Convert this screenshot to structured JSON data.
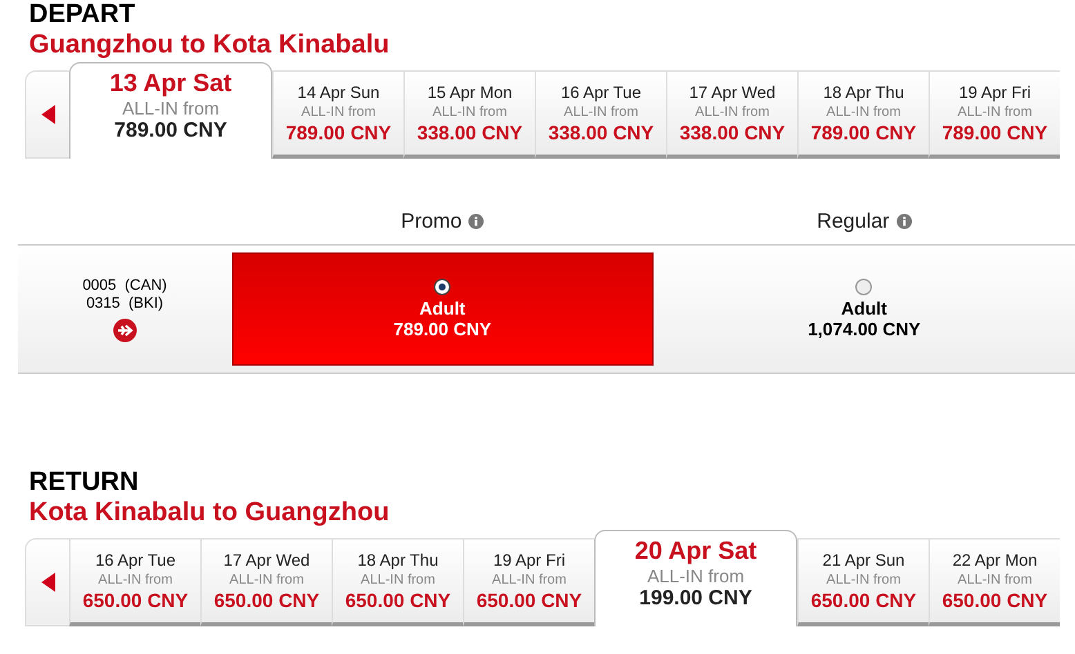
{
  "depart": {
    "heading": "DEPART",
    "route": "Guangzhou  to  Kota Kinabalu",
    "dates": [
      {
        "date": "13 Apr Sat",
        "label": "ALL-IN from",
        "price": "789.00 CNY",
        "selected": true
      },
      {
        "date": "14 Apr Sun",
        "label": "ALL-IN from",
        "price": "789.00 CNY",
        "selected": false
      },
      {
        "date": "15 Apr Mon",
        "label": "ALL-IN from",
        "price": "338.00 CNY",
        "selected": false
      },
      {
        "date": "16 Apr Tue",
        "label": "ALL-IN from",
        "price": "338.00 CNY",
        "selected": false
      },
      {
        "date": "17 Apr Wed",
        "label": "ALL-IN from",
        "price": "338.00 CNY",
        "selected": false
      },
      {
        "date": "18 Apr Thu",
        "label": "ALL-IN from",
        "price": "789.00 CNY",
        "selected": false
      },
      {
        "date": "19 Apr Fri",
        "label": "ALL-IN from",
        "price": "789.00 CNY",
        "selected": false
      }
    ]
  },
  "fares": {
    "columns": [
      {
        "label": "Promo"
      },
      {
        "label": "Regular"
      }
    ],
    "flight": {
      "lines": [
        "0005  (CAN)",
        "0315  (BKI)"
      ]
    },
    "options": [
      {
        "label": "Adult",
        "price": "789.00 CNY",
        "selected": true
      },
      {
        "label": "Adult",
        "price": "1,074.00 CNY",
        "selected": false
      }
    ]
  },
  "return": {
    "heading": "RETURN",
    "route": "Kota Kinabalu  to  Guangzhou",
    "dates": [
      {
        "date": "16 Apr Tue",
        "label": "ALL-IN from",
        "price": "650.00 CNY",
        "selected": false
      },
      {
        "date": "17 Apr Wed",
        "label": "ALL-IN from",
        "price": "650.00 CNY",
        "selected": false
      },
      {
        "date": "18 Apr Thu",
        "label": "ALL-IN from",
        "price": "650.00 CNY",
        "selected": false
      },
      {
        "date": "19 Apr Fri",
        "label": "ALL-IN from",
        "price": "650.00 CNY",
        "selected": false
      },
      {
        "date": "20 Apr Sat",
        "label": "ALL-IN from",
        "price": "199.00 CNY",
        "selected": true
      },
      {
        "date": "21 Apr Sun",
        "label": "ALL-IN from",
        "price": "650.00 CNY",
        "selected": false
      },
      {
        "date": "22 Apr Mon",
        "label": "ALL-IN from",
        "price": "650.00 CNY",
        "selected": false
      }
    ]
  }
}
